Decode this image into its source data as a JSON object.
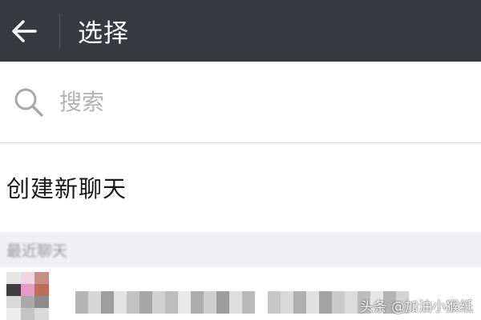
{
  "header": {
    "title": "选择",
    "background": "#393a3f"
  },
  "search": {
    "placeholder": "搜索",
    "value": ""
  },
  "actions": {
    "create_chat_label": "创建新聊天"
  },
  "recent": {
    "section_label": "最近聊天"
  },
  "watermark": {
    "text": "头条 @加油小猴纸"
  },
  "icons": {
    "back": "arrow-left-icon",
    "search": "search-icon"
  }
}
